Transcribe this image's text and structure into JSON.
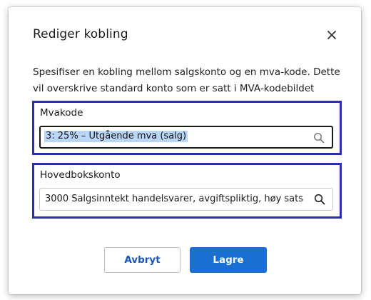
{
  "dialog": {
    "title": "Rediger kobling",
    "close_icon": "close-icon",
    "description_line1": "Spesifiser en kobling mellom salgskonto og en mva-kode. Dette",
    "description_line2": "vil overskrive standard konto som er satt i MVA-kodebildet"
  },
  "mvakode": {
    "label": "Mvakode",
    "value": "3: 25% – Utgående mva (salg)",
    "icon": "search-icon"
  },
  "hovedbokskonto": {
    "label": "Hovedbokskonto",
    "value": "3000 Salgsinntekt handelsvarer, avgiftspliktig, høy sats",
    "icon": "search-icon"
  },
  "buttons": {
    "cancel_label": "Avbryt",
    "save_label": "Lagre"
  },
  "colors": {
    "accent": "#1a6fd1",
    "highlight_border": "#2b2fa8",
    "selection": "#b9d6f8"
  }
}
